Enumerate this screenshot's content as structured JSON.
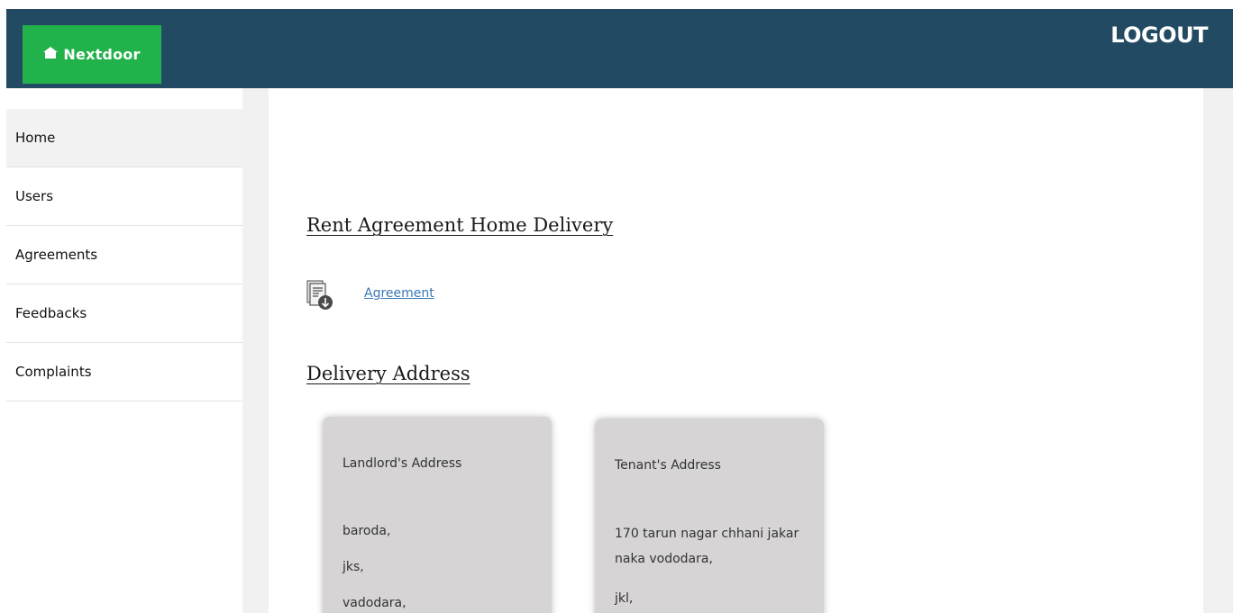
{
  "header": {
    "logo_text": "Nextdoor",
    "logout_label": "LOGOUT",
    "bar_color": "#234a63",
    "logo_color": "#22b24c"
  },
  "sidebar": {
    "items": [
      {
        "label": "Home"
      },
      {
        "label": "Users"
      },
      {
        "label": "Agreements"
      },
      {
        "label": "Feedbacks"
      },
      {
        "label": "Complaints"
      }
    ]
  },
  "main": {
    "rent_title": "Rent Agreement Home Delivery",
    "agreement_link": "Agreement",
    "delivery_title": "Delivery Address",
    "landlord": {
      "title": "Landlord's Address",
      "lines": [
        "baroda,",
        "jks,",
        "vadodara,"
      ]
    },
    "tenant": {
      "title": "Tenant's Address",
      "lines": [
        "170 tarun nagar chhani jakar naka vododara,",
        "jkl,"
      ]
    }
  }
}
